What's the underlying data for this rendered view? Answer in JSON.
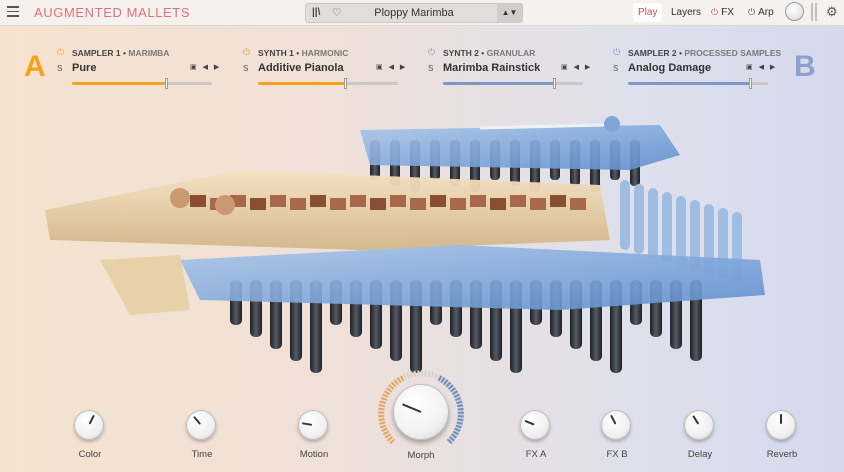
{
  "app": {
    "title": "AUGMENTED MALLETS"
  },
  "preset": {
    "name": "Ploppy Marimba",
    "arrows": "▲▼"
  },
  "tabs": {
    "play": "Play",
    "layers": "Layers",
    "fx": "FX",
    "arp": "Arp"
  },
  "sides": {
    "a": "A",
    "b": "B"
  },
  "slots": [
    {
      "type": "SAMPLER 1 •",
      "sub": "MARIMBA",
      "s": "S",
      "name": "Pure",
      "accent": "#f5a31a",
      "level": 0.67,
      "on": true
    },
    {
      "type": "SYNTH 1 •",
      "sub": "HARMONIC",
      "s": "S",
      "name": "Additive Pianola",
      "accent": "#f5a31a",
      "level": 0.62,
      "on": true
    },
    {
      "type": "SYNTH 2 •",
      "sub": "GRANULAR",
      "s": "S",
      "name": "Marimba Rainstick",
      "accent": "#7e97c9",
      "level": 0.79,
      "on": true
    },
    {
      "type": "SAMPLER 2 •",
      "sub": "PROCESSED SAMPLES",
      "s": "S",
      "name": "Analog Damage",
      "accent": "#7e97c9",
      "level": 0.87,
      "on": true
    }
  ],
  "knobs": [
    {
      "label": "Color",
      "value": 0.6
    },
    {
      "label": "Time",
      "value": 0.35
    },
    {
      "label": "Motion",
      "value": 0.2
    },
    {
      "label": "FX A",
      "value": 0.25
    },
    {
      "label": "FX B",
      "value": 0.4
    },
    {
      "label": "Delay",
      "value": 0.38
    },
    {
      "label": "Reverb",
      "value": 0.5
    }
  ],
  "morph": {
    "label": "Morph",
    "value": 0.25
  },
  "colors": {
    "accent_a": "#f5a31a",
    "accent_b": "#7e97c9",
    "title": "#e0707a",
    "power_on": "#c85060"
  }
}
